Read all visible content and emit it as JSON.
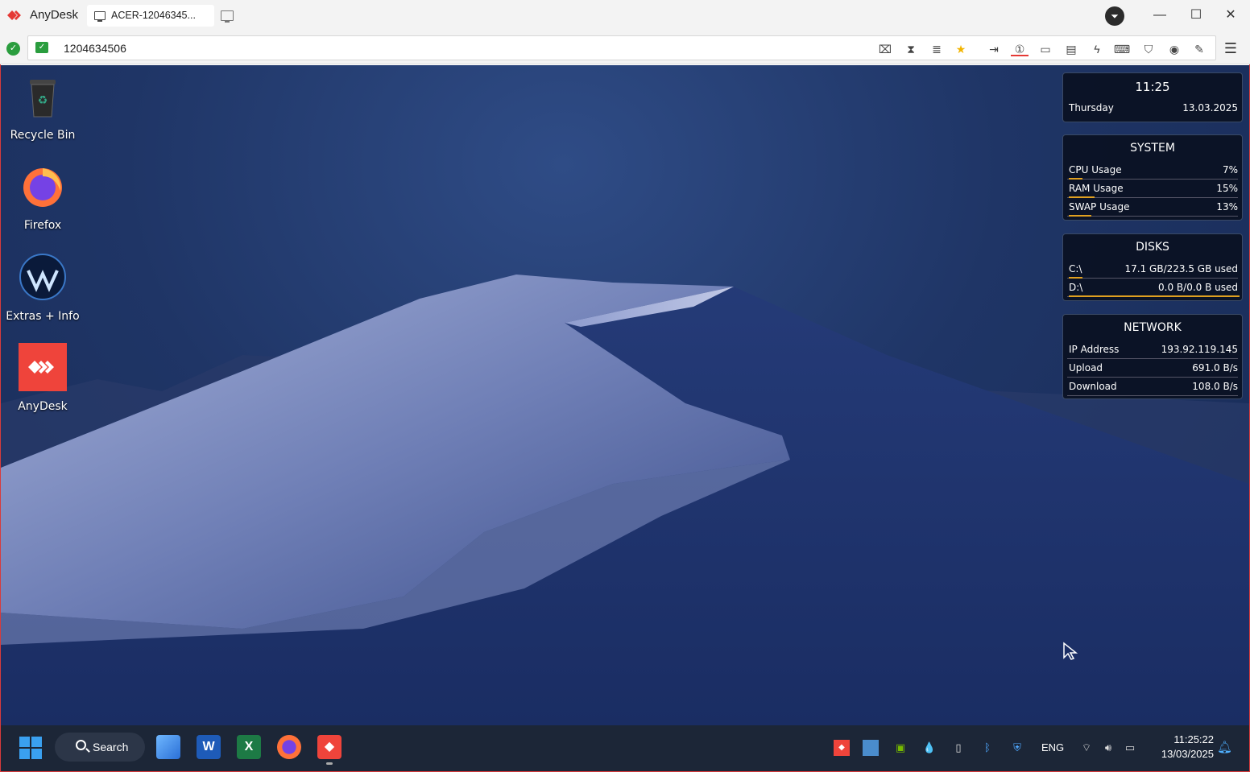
{
  "app": {
    "name": "AnyDesk",
    "tab_label": "ACER-12046345...",
    "account_initial": "⏷"
  },
  "window_controls": {
    "minimize": "—",
    "maximize": "☐",
    "close": "✕"
  },
  "address": {
    "value": "1204634506"
  },
  "toolbar_icons": [
    "privacy-icon",
    "hourglass-icon",
    "database-icon",
    "star-icon",
    "file-transfer-icon",
    "monitor-switch-icon",
    "display-icon",
    "chat-icon",
    "actions-icon",
    "keyboard-icon",
    "permissions-icon",
    "record-icon",
    "whiteboard-icon"
  ],
  "desktop_icons": [
    {
      "name": "recycle-bin",
      "label": "Recycle Bin"
    },
    {
      "name": "firefox",
      "label": "Firefox"
    },
    {
      "name": "extras-info",
      "label": "Extras + Info"
    },
    {
      "name": "anydesk",
      "label": "AnyDesk"
    }
  ],
  "widgets": {
    "clock": {
      "time": "11:25",
      "day": "Thursday",
      "date": "13.03.2025"
    },
    "system": {
      "title": "SYSTEM",
      "rows": [
        {
          "label": "CPU Usage",
          "value": "7%",
          "fill": 0.07
        },
        {
          "label": "RAM Usage",
          "value": "15%",
          "fill": 0.15
        },
        {
          "label": "SWAP Usage",
          "value": "13%",
          "fill": 0.13
        }
      ]
    },
    "disks": {
      "title": "DISKS",
      "rows": [
        {
          "label": "C:\\",
          "value": "17.1 GB/223.5 GB used",
          "fill": 0.077
        },
        {
          "label": "D:\\",
          "value": "0.0 B/0.0 B used",
          "fill": 1.0
        }
      ]
    },
    "network": {
      "title": "NETWORK",
      "rows": [
        {
          "label": "IP Address",
          "value": "193.92.119.145"
        },
        {
          "label": "Upload",
          "value": "691.0 B/s"
        },
        {
          "label": "Download",
          "value": "108.0 B/s"
        }
      ]
    }
  },
  "taskbar": {
    "search_label": "Search",
    "apps": [
      "file-explorer",
      "word",
      "excel",
      "firefox",
      "anydesk"
    ],
    "tray_icons": [
      "anydesk-tray-icon",
      "network-monitor-icon",
      "nvidia-icon",
      "drop-icon",
      "usb-icon",
      "bluetooth-icon",
      "defender-warning-icon"
    ],
    "language": "ENG",
    "time": "11:25:22",
    "date": "13/03/2025"
  }
}
